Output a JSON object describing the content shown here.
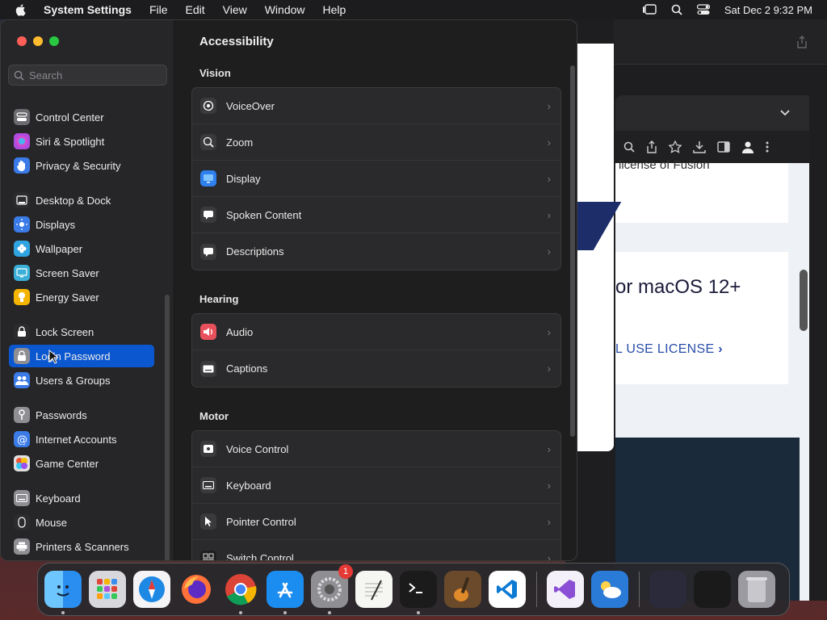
{
  "menubar": {
    "app": "System Settings",
    "items": [
      "File",
      "Edit",
      "View",
      "Window",
      "Help"
    ],
    "clock": "Sat Dec 2  9:32 PM"
  },
  "browser": {
    "card1_text": "license of Fusion",
    "card2_title": "or macOS 12+",
    "card2_link": "L USE LICENSE"
  },
  "settings": {
    "search_placeholder": "Search",
    "sidebar": [
      {
        "label": "Control Center",
        "icon": "control-center-icon",
        "color": "#6b6b70"
      },
      {
        "label": "Siri & Spotlight",
        "icon": "siri-icon",
        "color": "#b04be0"
      },
      {
        "label": "Privacy & Security",
        "icon": "hand-icon",
        "color": "#3a7be8"
      },
      {
        "label": "Desktop & Dock",
        "icon": "dock-icon",
        "color": "#2c2c2e"
      },
      {
        "label": "Displays",
        "icon": "sun-icon",
        "color": "#3a7be8"
      },
      {
        "label": "Wallpaper",
        "icon": "flower-icon",
        "color": "#2fa4e0"
      },
      {
        "label": "Screen Saver",
        "icon": "screen-saver-icon",
        "color": "#3ab0d8"
      },
      {
        "label": "Energy Saver",
        "icon": "bulb-icon",
        "color": "#f5b400"
      },
      {
        "label": "Lock Screen",
        "icon": "lock-icon",
        "color": "#2c2c2e"
      },
      {
        "label": "Login Password",
        "icon": "padlock-icon",
        "color": "#8e8e93"
      },
      {
        "label": "Users & Groups",
        "icon": "users-icon",
        "color": "#3a7be8"
      },
      {
        "label": "Passwords",
        "icon": "key-icon",
        "color": "#8e8e93"
      },
      {
        "label": "Internet Accounts",
        "icon": "at-icon",
        "color": "#3a7be8"
      },
      {
        "label": "Game Center",
        "icon": "game-center-icon",
        "color": "#e0e0e0"
      },
      {
        "label": "Keyboard",
        "icon": "keyboard-icon",
        "color": "#8e8e93"
      },
      {
        "label": "Mouse",
        "icon": "mouse-icon",
        "color": "#2c2c2e"
      },
      {
        "label": "Printers & Scanners",
        "icon": "printer-icon",
        "color": "#8e8e93"
      }
    ],
    "selected_index": 9,
    "main": {
      "title": "Accessibility",
      "sections": [
        {
          "title": "Vision",
          "rows": [
            {
              "label": "VoiceOver",
              "icon": "voiceover-icon"
            },
            {
              "label": "Zoom",
              "icon": "zoom-icon"
            },
            {
              "label": "Display",
              "icon": "display-icon"
            },
            {
              "label": "Spoken Content",
              "icon": "spoken-content-icon"
            },
            {
              "label": "Descriptions",
              "icon": "descriptions-icon"
            }
          ]
        },
        {
          "title": "Hearing",
          "rows": [
            {
              "label": "Audio",
              "icon": "audio-icon"
            },
            {
              "label": "Captions",
              "icon": "captions-icon"
            }
          ]
        },
        {
          "title": "Motor",
          "rows": [
            {
              "label": "Voice Control",
              "icon": "voice-control-icon"
            },
            {
              "label": "Keyboard",
              "icon": "keyboard-icon"
            },
            {
              "label": "Pointer Control",
              "icon": "pointer-icon"
            },
            {
              "label": "Switch Control",
              "icon": "switch-control-icon"
            }
          ]
        }
      ]
    }
  },
  "dock": {
    "apps": [
      "finder-icon",
      "launchpad-icon",
      "safari-icon",
      "firefox-icon",
      "chrome-icon",
      "app-store-icon",
      "system-settings-icon",
      "textedit-icon",
      "terminal-icon",
      "garageband-icon",
      "vscode-icon",
      "visual-studio-icon",
      "weather-icon"
    ],
    "settings_badge": "1"
  }
}
